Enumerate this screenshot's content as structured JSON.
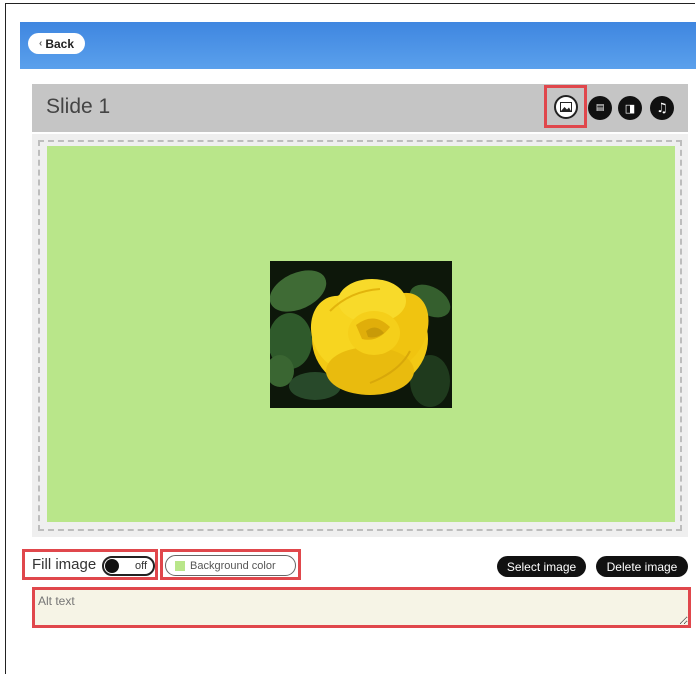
{
  "topbar": {
    "back_label": "Back"
  },
  "slide": {
    "title": "Slide 1"
  },
  "toolbar": {
    "icons": [
      "image-icon",
      "caption-icon",
      "sticker-icon",
      "music-icon"
    ],
    "image_icon_glyph": "🖼",
    "caption_icon_glyph": "▤",
    "sticker_icon_glyph": "◨",
    "music_icon_glyph": "♫"
  },
  "canvas": {
    "background_color": "#b9e68a",
    "image_description_label": ""
  },
  "controls": {
    "fill_image_label": "Fill image",
    "fill_image_state": "off",
    "background_color_label": "Background color",
    "select_image_label": "Select image",
    "delete_image_label": "Delete image"
  },
  "alt_text": {
    "placeholder": "Alt text",
    "value": ""
  },
  "colors": {
    "highlight": "#e0474c",
    "topbar": "#4a90e2",
    "canvas": "#b9e68a"
  }
}
